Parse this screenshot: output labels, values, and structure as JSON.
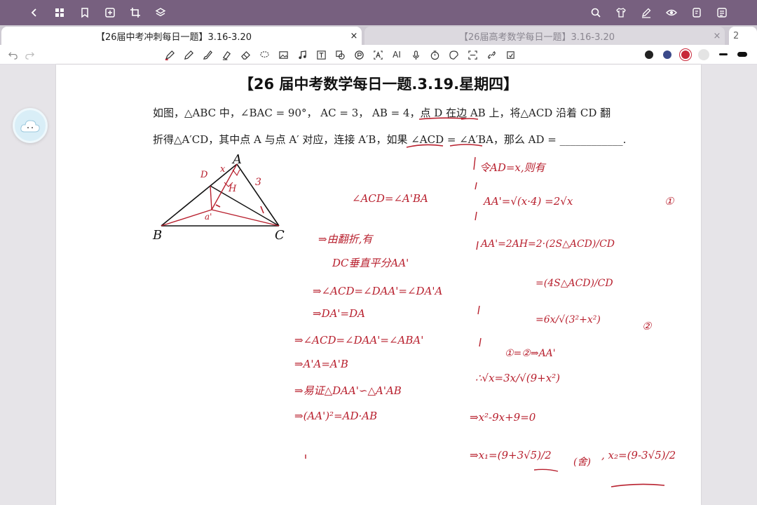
{
  "tabs": [
    {
      "label": "【26届中考冲刺每日一题】3.16-3.20",
      "close": "×"
    },
    {
      "label": "【26届高考数学每日一题】3.16-3.20",
      "close": "×"
    },
    {
      "label": "2"
    }
  ],
  "colors": {
    "topbar": "#77607f",
    "ink_red": "#b8202e",
    "pen_black": "#222222",
    "pen_blue": "#3b4a8a",
    "pen_red": "#c8283a"
  },
  "icons": {
    "topbar_left": [
      "back-icon",
      "grid-icon",
      "bookmark-icon",
      "add-page-icon",
      "crop-icon",
      "layers-icon"
    ],
    "topbar_right": [
      "search-icon",
      "shirt-icon",
      "pen-edit-icon",
      "eye-icon",
      "page-icon",
      "more-icon"
    ],
    "tools": [
      "fountain-pen-icon",
      "pencil-icon",
      "brush-icon",
      "highlighter-icon",
      "eraser-icon",
      "lasso-icon",
      "image-icon",
      "music-icon",
      "text-icon",
      "shape-icon",
      "ocr-icon",
      "text-box-icon",
      "ai-icon",
      "mic-icon",
      "timer-icon",
      "sticker-icon",
      "scan-icon",
      "link-icon",
      "crop-tool-icon"
    ]
  },
  "toolbar": {
    "ai_label": "AI"
  },
  "document": {
    "title": "【26 届中考数学每日一题.3.19.星期四】",
    "question_line1": "如图，△ABC 中，∠BAC = 90°， AC = 3， AB = 4，点 D 在边 AB 上，将△ACD 沿着 CD 翻",
    "question_line2": "折得△A′CD，其中点 A 与点 A′ 对应，连接 A′B，如果 ∠ACD = ∠A′BA，那么 AD = ____________.",
    "figure_labels": {
      "A": "A",
      "B": "B",
      "C": "C",
      "D": "D",
      "H": "H",
      "A_prime": "a'",
      "x": "x",
      "three": "3"
    }
  },
  "handwriting": {
    "left": [
      "∠ACD=∠A'BA",
      "⇒由翻折,有",
      "DC垂直平分AA'",
      "⇒∠ACD=∠DAA'=∠DA'A",
      "⇒DA'=DA",
      "⇒∠ACD=∠DAA'=∠ABA'",
      "⇒A'A=A'B",
      "⇒易证△DAA'∽△A'AB",
      "⇒(AA')²=AD·AB"
    ],
    "right": [
      "令AD=x,则有",
      "AA'=√(x·4) =2√x",
      "①",
      "AA'=2AH=2·(2S△ACD)/CD",
      "=(4S△ACD)/CD",
      "=6x/√(3²+x²)",
      "②",
      "①=②⇒AA'",
      "∴√x=3x/√(9+x²)",
      "⇒x²-9x+9=0",
      "⇒x₁=(9+3√5)/2",
      "(舍)",
      ", x₂=(9-3√5)/2"
    ]
  }
}
